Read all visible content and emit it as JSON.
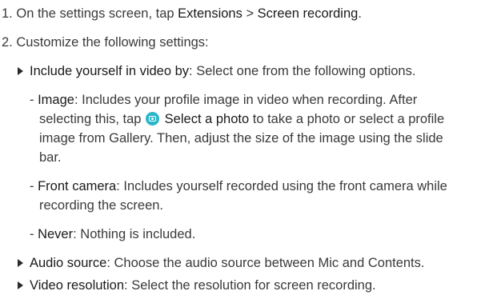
{
  "steps": [
    {
      "number": "1.",
      "text_a": "On the settings screen, tap ",
      "term1": "Extensions",
      "sep": " > ",
      "term2": "Screen recording",
      "text_b": "."
    },
    {
      "number": "2.",
      "text": "Customize the following settings:"
    }
  ],
  "settings": [
    {
      "name": "Include yourself in video by",
      "description": ": Select one from the following options.",
      "options": [
        {
          "dash": "- ",
          "name": "Image",
          "line1": ": Includes your profile image in video when recording. After",
          "line2_a": "selecting this, tap ",
          "line2_icon": "camera-icon",
          "line2_term": "Select a photo",
          "line2_b": " to take a photo or select a profile",
          "line3": "image from Gallery. Then, adjust the size of the image using the slide",
          "line4": "bar."
        },
        {
          "dash": "- ",
          "name": "Front camera",
          "line1": ": Includes yourself recorded using the front camera while",
          "line2": "recording the screen."
        },
        {
          "dash": "- ",
          "name": "Never",
          "line1": ": Nothing is included."
        }
      ]
    },
    {
      "name": "Audio source",
      "description": ": Choose the audio source between Mic and Contents."
    },
    {
      "name": "Video resolution",
      "description": ": Select the resolution for screen recording."
    }
  ],
  "colors": {
    "text": "#3a3a3a",
    "bullet": "#2a2a2a",
    "icon_bg": "#2bb6c9"
  }
}
